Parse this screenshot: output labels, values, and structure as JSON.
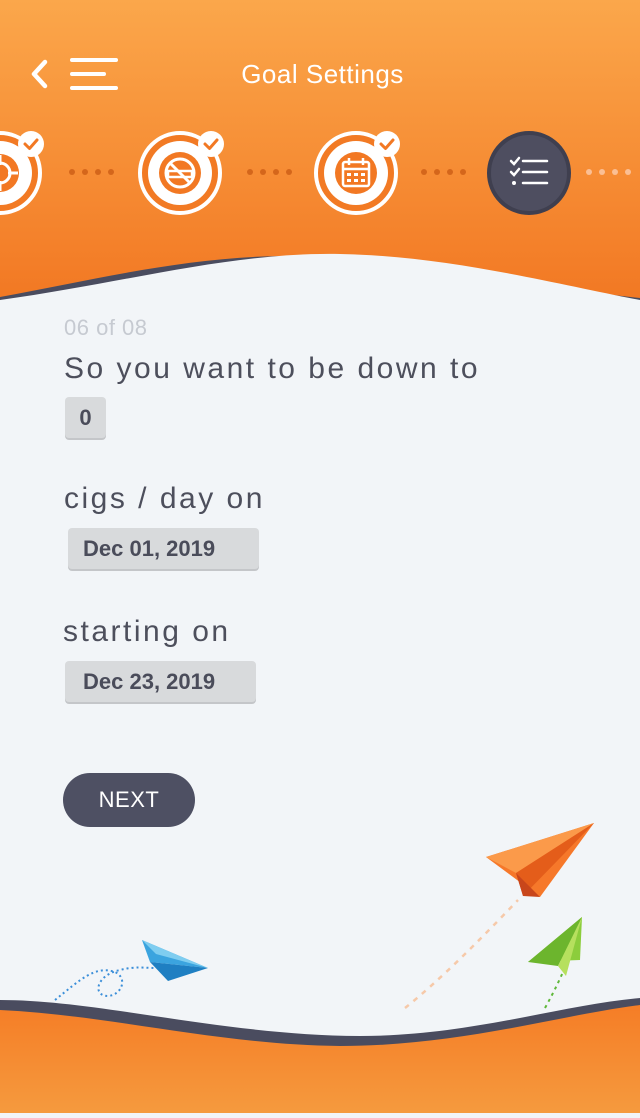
{
  "header": {
    "title": "Goal Settings",
    "back_icon": "chevron-left-icon",
    "menu_icon": "hamburger-menu-icon",
    "gradient_top": "#fba74b",
    "gradient_bottom": "#f27823",
    "wave_dark": "#4a4c5f"
  },
  "steps": [
    {
      "icon": "target-icon",
      "state": "completed"
    },
    {
      "icon": "no-smoking-icon",
      "state": "completed"
    },
    {
      "icon": "calendar-icon",
      "state": "completed"
    },
    {
      "icon": "checklist-icon",
      "state": "current"
    }
  ],
  "form": {
    "progress": "06 of 08",
    "prompt_1": "So you want to be down to",
    "cigs_value": "0",
    "prompt_2": "cigs / day on",
    "target_date": "Dec 01, 2019",
    "prompt_3": "starting on",
    "start_date": "Dec 23, 2019",
    "next_label": "NEXT"
  },
  "colors": {
    "accent": "#f27823",
    "dark": "#4e5063",
    "background": "#f2f5f8",
    "chip": "#d8dadc"
  },
  "decorations": [
    "paper-plane-orange-icon",
    "paper-plane-green-icon",
    "paper-plane-blue-icon"
  ]
}
